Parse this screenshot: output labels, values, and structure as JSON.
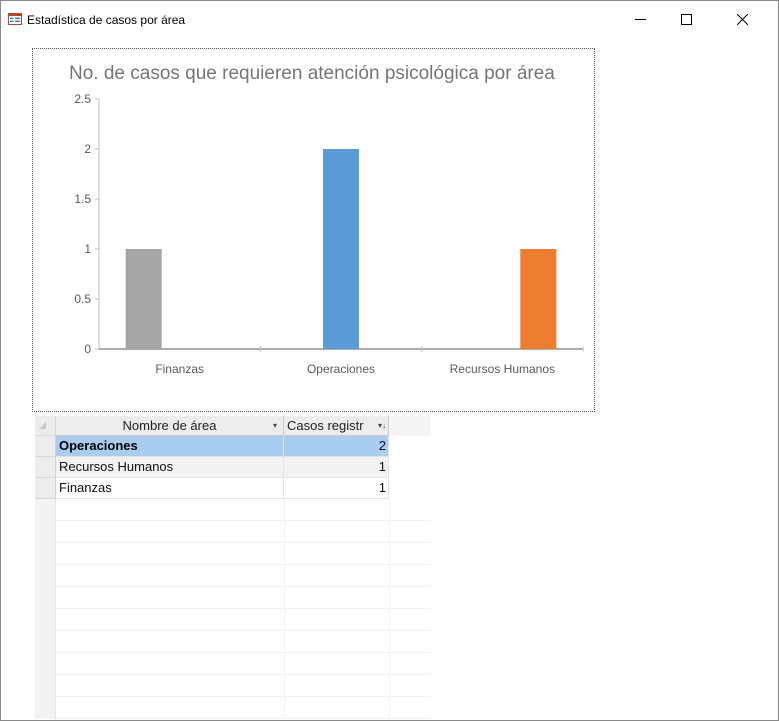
{
  "window": {
    "title": "Estadística de casos por área",
    "controls": {
      "minimize": "minimize-icon",
      "maximize": "maximize-icon",
      "close": "close-icon"
    }
  },
  "chart_data": {
    "type": "bar",
    "title": "No. de casos que requieren atención psicológica por área",
    "categories": [
      "Finanzas",
      "Operaciones",
      "Recursos Humanos"
    ],
    "series": [
      {
        "values": [
          1,
          null,
          null
        ],
        "color": "#a5a5a5"
      },
      {
        "values": [
          null,
          2,
          null
        ],
        "color": "#5b9bd5"
      },
      {
        "values": [
          null,
          null,
          1
        ],
        "color": "#ed7d31"
      }
    ],
    "ylim": [
      0,
      2.5
    ],
    "yticks": [
      "0",
      "0.5",
      "1",
      "1.5",
      "2",
      "2.5"
    ],
    "ytick_values": [
      0,
      0.5,
      1,
      1.5,
      2,
      2.5
    ],
    "grid": false,
    "legend": "none"
  },
  "datasheet": {
    "columns": [
      {
        "label": "Nombre de área",
        "sort": "▾"
      },
      {
        "label": "Casos registr",
        "sort": "▾↓"
      }
    ],
    "rows": [
      {
        "name": "Operaciones",
        "count": "2",
        "selected": true
      },
      {
        "name": "Recursos Humanos",
        "count": "1",
        "selected": false
      },
      {
        "name": "Finanzas",
        "count": "1",
        "selected": false
      }
    ]
  },
  "colors": {
    "selection": "#a9cdf1",
    "header": "#ececec",
    "title_text": "#757575"
  }
}
